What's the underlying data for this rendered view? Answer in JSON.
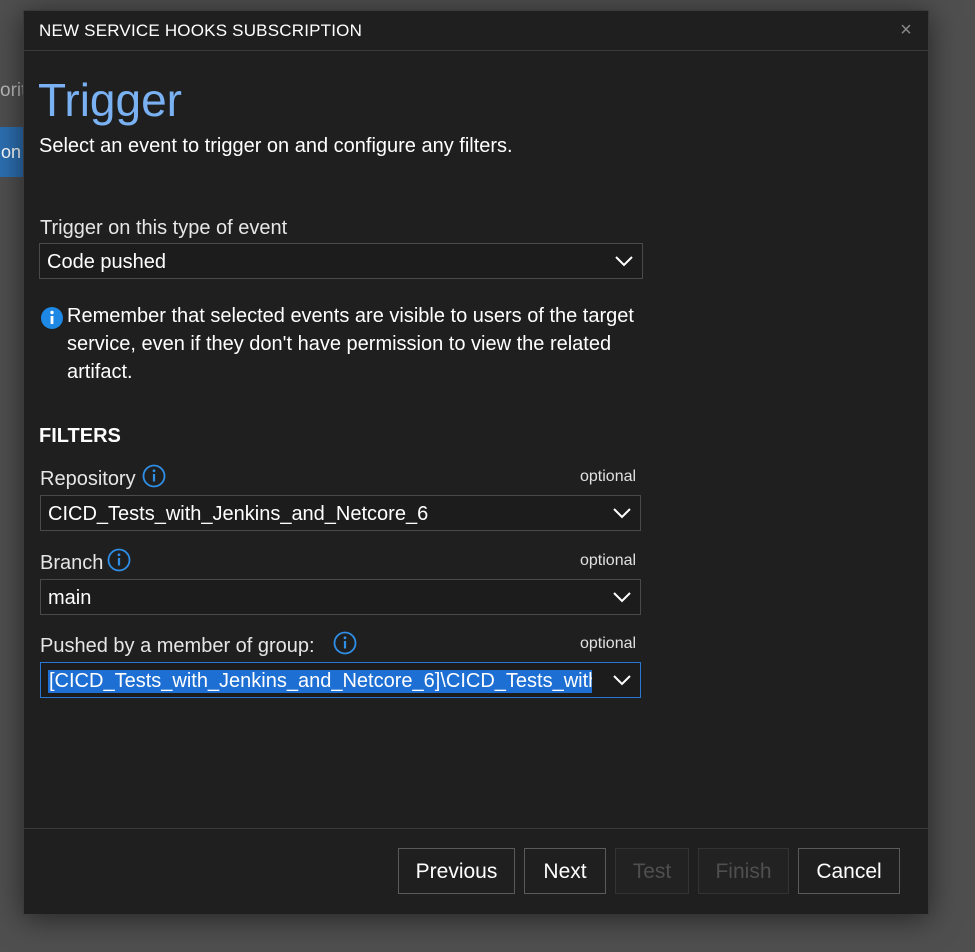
{
  "background": {
    "text_fragment": "orit",
    "button_fragment": "on"
  },
  "dialog": {
    "title": "NEW SERVICE HOOKS SUBSCRIPTION",
    "close_icon": "close-icon",
    "close_glyph": "×"
  },
  "trigger": {
    "title": "Trigger",
    "subtitle": "Select an event to trigger on and configure any filters.",
    "event_type_label": "Trigger on this type of event",
    "event_type_value": "Code pushed",
    "info_note": "Remember that selected events are visible to users of the target service, even if they don't have permission to view the related artifact."
  },
  "filters": {
    "heading": "FILTERS",
    "repository": {
      "label": "Repository",
      "optional": "optional",
      "value": "CICD_Tests_with_Jenkins_and_Netcore_6"
    },
    "branch": {
      "label": "Branch",
      "optional": "optional",
      "value": "main"
    },
    "group": {
      "label": "Pushed by a member of group:",
      "optional": "optional",
      "value": "[CICD_Tests_with_Jenkins_and_Netcore_6]\\CICD_Tests_with"
    }
  },
  "footer": {
    "previous": "Previous",
    "next": "Next",
    "test": "Test",
    "finish": "Finish",
    "cancel": "Cancel"
  },
  "colors": {
    "accent": "#79b1f2",
    "info_icon": "#1e88e5",
    "selection": "#1e6fd3",
    "dialog_bg": "#1f1f1f"
  }
}
